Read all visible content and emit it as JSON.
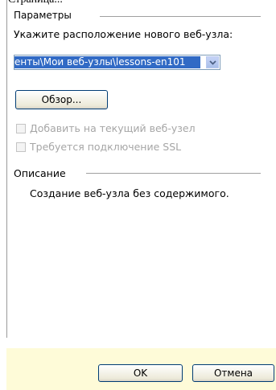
{
  "page_caption_fragment": "Страница...",
  "params": {
    "group_label": "Параметры",
    "location_prompt": "Укажите расположение нового веб-узла:",
    "location_value": "енты\\Мои веб-узлы\\lessons-en101",
    "browse_label": "Обзор...",
    "add_to_current": {
      "label": "Добавить на текущий веб-узел",
      "checked": false,
      "disabled": true
    },
    "require_ssl": {
      "label": "Требуется подключение SSL",
      "checked": false,
      "disabled": true
    }
  },
  "description": {
    "group_label": "Описание",
    "text": "Создание веб-узла без содержимого."
  },
  "buttons": {
    "ok": "OK",
    "cancel": "Отмена"
  },
  "colors": {
    "selection": "#316ac5",
    "footer_bg": "#fefbd8",
    "button_border": "#003c74"
  }
}
